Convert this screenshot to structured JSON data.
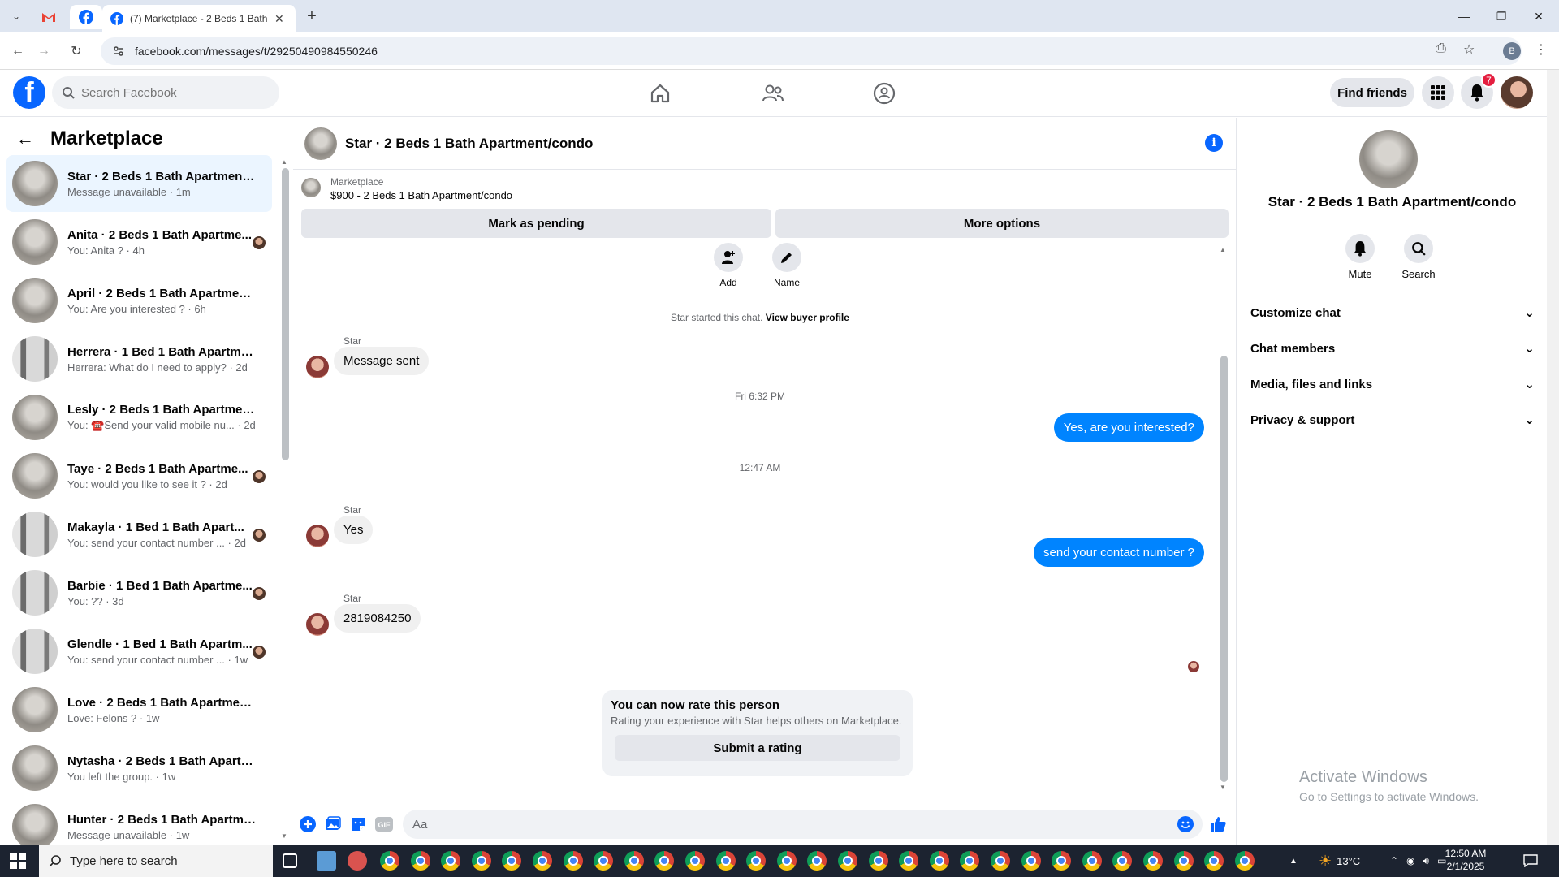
{
  "browser": {
    "tab_title": "(7) Marketplace - 2 Beds 1 Bath",
    "url": "facebook.com/messages/t/29250490984550246",
    "profile_initial": "B"
  },
  "fb": {
    "search_placeholder": "Search Facebook",
    "find_friends": "Find friends",
    "notification_count": "7"
  },
  "sidebar": {
    "title": "Marketplace",
    "conversations": [
      {
        "name": "Star · 2 Beds 1 Bath Apartment/...",
        "snippet": "Message unavailable · 1m",
        "active": true
      },
      {
        "name": "Anita · 2 Beds 1 Bath Apartme...",
        "snippet": "You: Anita ? · 4h"
      },
      {
        "name": "April · 2 Beds 1 Bath Apartment/...",
        "snippet": "You: Are you interested ? · 6h"
      },
      {
        "name": "Herrera · 1 Bed 1 Bath Apartmen...",
        "snippet": "Herrera: What do I need to apply? · 2d"
      },
      {
        "name": "Lesly · 2 Beds 1 Bath Apartment...",
        "snippet": "You: ☎️Send your valid mobile nu... · 2d"
      },
      {
        "name": "Taye · 2 Beds 1 Bath Apartme...",
        "snippet": "You: would you like to see it ? · 2d"
      },
      {
        "name": "Makayla · 1 Bed 1 Bath Apart...",
        "snippet": "You: send your contact number ... · 2d"
      },
      {
        "name": "Barbie · 1 Bed 1 Bath Apartme...",
        "snippet": "You: ?? · 3d"
      },
      {
        "name": "Glendle · 1 Bed 1 Bath Apartm...",
        "snippet": "You: send your contact number ... · 1w"
      },
      {
        "name": "Love · 2 Beds 1 Bath Apartment/...",
        "snippet": "Love: Felons ? · 1w"
      },
      {
        "name": "Nytasha · 2 Beds 1 Bath Apartm...",
        "snippet": "You left the group. · 1w"
      },
      {
        "name": "Hunter · 2 Beds 1 Bath Apartme...",
        "snippet": "Message unavailable · 1w"
      }
    ]
  },
  "chat": {
    "title": "Star · 2 Beds 1 Bath Apartment/condo",
    "listing_label": "Marketplace",
    "listing_price": "$900 - 2 Beds 1 Bath Apartment/condo",
    "mark_pending": "Mark as pending",
    "more_options": "More options",
    "add_label": "Add",
    "name_label": "Name",
    "started_text": "Star started this chat.",
    "view_profile": "View buyer profile",
    "sender_name": "Star",
    "msg1": "Message sent",
    "time1": "Fri 6:32 PM",
    "out1": "Yes, are you interested?",
    "time2": "12:47 AM",
    "msg2": "Yes",
    "out2": "send your contact number ?",
    "msg3": "2819084250",
    "rate_title": "You can now rate this person",
    "rate_sub": "Rating your experience with Star helps others on Marketplace.",
    "rate_btn": "Submit a rating",
    "composer_placeholder": "Aa"
  },
  "info": {
    "title": "Star · 2 Beds 1 Bath Apartment/condo",
    "mute": "Mute",
    "search": "Search",
    "sections": [
      "Customize chat",
      "Chat members",
      "Media, files and links",
      "Privacy & support"
    ],
    "activate_title": "Activate Windows",
    "activate_sub": "Go to Settings to activate Windows."
  },
  "taskbar": {
    "search_placeholder": "Type here to search",
    "weather": "13°C",
    "time": "12:50 AM",
    "date": "2/1/2025"
  },
  "colors": {
    "fb_blue": "#0866ff",
    "out_bubble": "#0084ff",
    "badge_red": "#e41e3f"
  }
}
